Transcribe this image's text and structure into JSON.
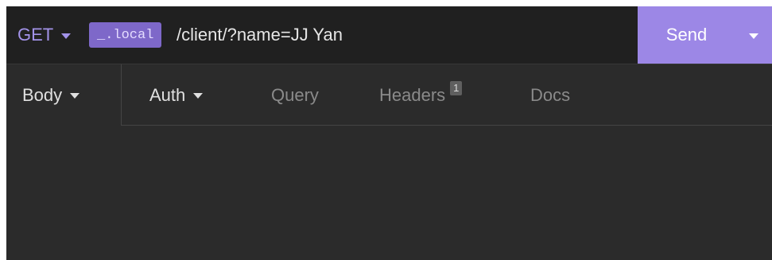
{
  "request": {
    "method": "GET",
    "env_tag": "_.local",
    "path": "/client/?name=JJ Yan"
  },
  "send": {
    "label": "Send"
  },
  "tabs": {
    "body": "Body",
    "auth": "Auth",
    "query": "Query",
    "headers": "Headers",
    "headers_count": "1",
    "docs": "Docs"
  },
  "colors": {
    "accent": "#9c87e6",
    "method": "#a393e9",
    "env_tag_bg": "#7e68c9",
    "background": "#2b2b2b"
  }
}
